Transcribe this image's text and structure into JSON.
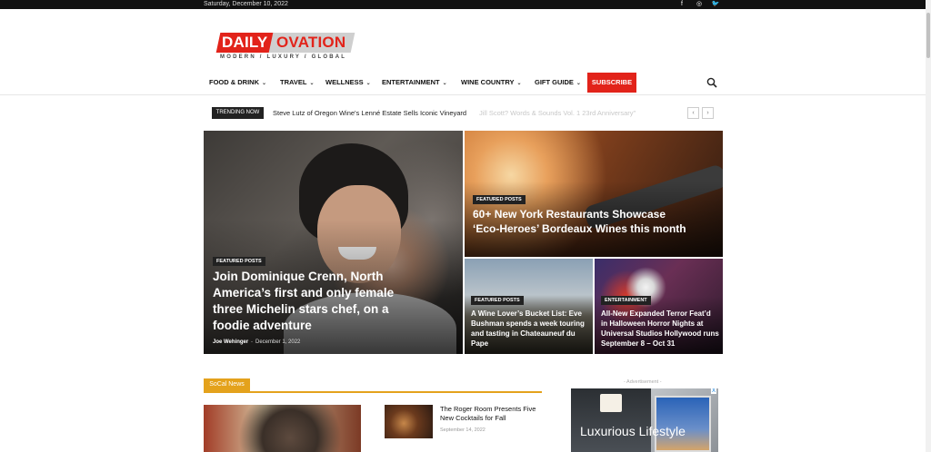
{
  "topbar": {
    "date": "Saturday, December 10, 2022",
    "social": [
      {
        "icon": "facebook-icon",
        "glyph": "f"
      },
      {
        "icon": "instagram-icon",
        "glyph": "◎"
      },
      {
        "icon": "twitter-icon",
        "glyph": "🐦"
      }
    ]
  },
  "logo": {
    "word1": "DAILY",
    "word2": "OVATION",
    "tagline": "MODERN / LUXURY / GLOBAL"
  },
  "nav": {
    "items": [
      {
        "label": "FOOD & DRINK"
      },
      {
        "label": "TRAVEL"
      },
      {
        "label": "WELLNESS"
      },
      {
        "label": "ENTERTAINMENT"
      },
      {
        "label": "WINE COUNTRY"
      },
      {
        "label": "GIFT GUIDE"
      }
    ],
    "subscribe": "SUBSCRIBE"
  },
  "trending": {
    "label": "TRENDING NOW",
    "headline": "Steve Lutz of Oregon Wine's Lenné Estate Sells Iconic Vineyard",
    "ghost": "Jill Scott? Words & Sounds Vol. 1 23rd Anniversary\""
  },
  "tiles": [
    {
      "badge": "FEATURED POSTS",
      "title": "Join Dominique Crenn, North America’s first and only female three Michelin stars chef, on a foodie adventure",
      "author": "Joe Wehinger",
      "date": "December 1, 2022"
    },
    {
      "badge": "FEATURED POSTS",
      "title": "60+ New York Restaurants Showcase ‘Eco-Heroes’ Bordeaux Wines this month"
    },
    {
      "badge": "FEATURED POSTS",
      "title": "A Wine Lover’s Bucket List: Eve Bushman spends a week touring and tasting in Chateauneuf du Pape"
    },
    {
      "badge": "ENTERTAINMENT",
      "title": "All-New Expanded Terror Feat’d in Halloween Horror Nights at Universal Studios Hollywood runs September 8 – Oct 31"
    }
  ],
  "section": {
    "title": "SoCal News"
  },
  "news": [
    {
      "title": "The Roger Room Presents Five New Cocktails for Fall",
      "date": "September 14, 2022"
    }
  ],
  "ad": {
    "label": "- Advertisement -",
    "text": "Luxurious Lifestyle",
    "close": "X"
  }
}
